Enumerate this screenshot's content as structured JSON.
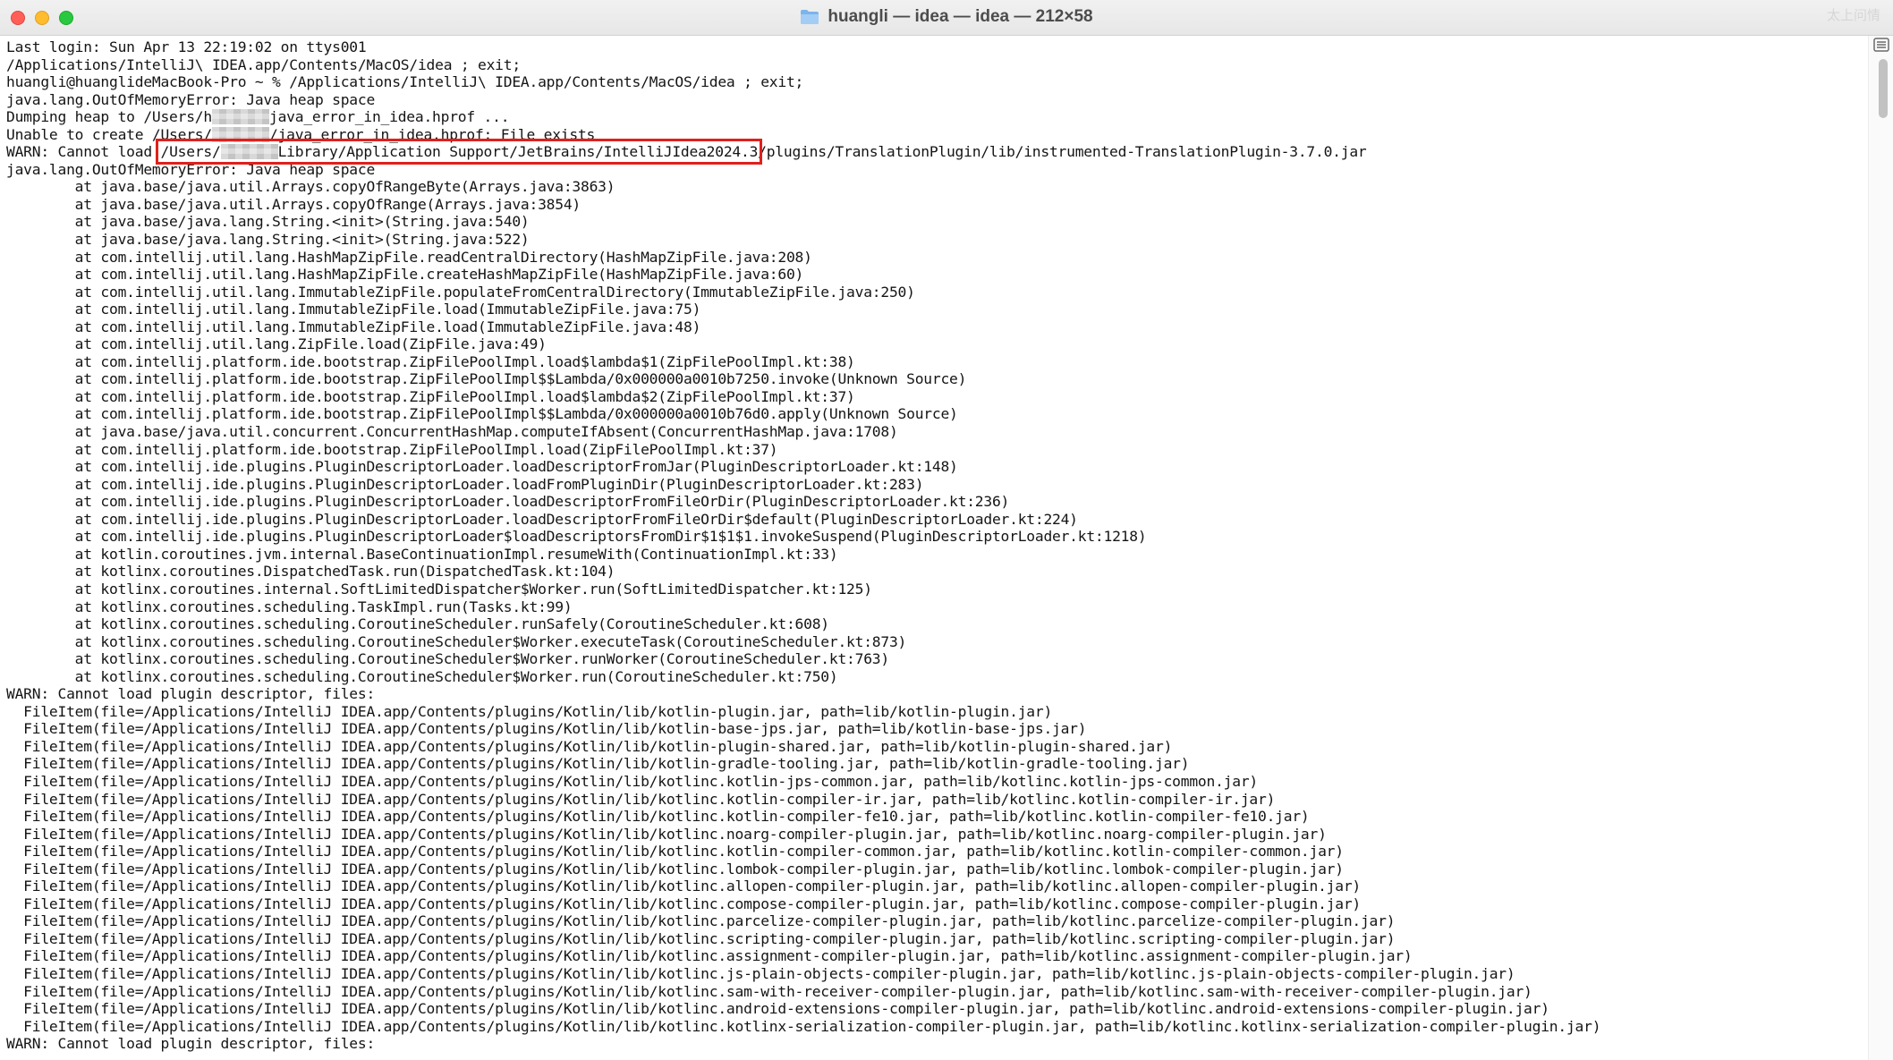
{
  "window": {
    "title": "huangli — idea — idea — 212×58",
    "watermark": "太上问情",
    "icon": "folder-icon",
    "controls": [
      "close-icon",
      "minimize-icon",
      "maximize-icon"
    ]
  },
  "terminal": {
    "highlight_color": "#e0201b",
    "lines": [
      [
        "Last login: Sun Apr 13 22:19:02 on ttys001"
      ],
      [
        "/Applications/IntelliJ\\ IDEA.app/Contents/MacOS/idea ; exit;"
      ],
      [
        "huangli@huanglideMacBook-Pro ~ % /Applications/IntelliJ\\ IDEA.app/Contents/MacOS/idea ; exit;"
      ],
      [
        "java.lang.OutOfMemoryError: Java heap space"
      ],
      [
        "Dumping heap to /Users/h",
        {
          "blur": true
        },
        "java_error_in_idea.hprof ..."
      ],
      [
        "Unable to create /Users/",
        {
          "blur": true
        },
        "/java_error_in_idea.hprof: File exists"
      ],
      [
        "WARN: Cannot load ",
        {
          "hl": "/Users/",
          "blur": true,
          "hl_end": "Library/Application Support/JetBrains/IntelliJIdea2024.3"
        },
        "/plugins/TranslationPlugin/lib/instrumented-TranslationPlugin-3.7.0.jar"
      ],
      [
        "java.lang.OutOfMemoryError: Java heap space"
      ],
      [
        "        at java.base/java.util.Arrays.copyOfRangeByte(Arrays.java:3863)"
      ],
      [
        "        at java.base/java.util.Arrays.copyOfRange(Arrays.java:3854)"
      ],
      [
        "        at java.base/java.lang.String.<init>(String.java:540)"
      ],
      [
        "        at java.base/java.lang.String.<init>(String.java:522)"
      ],
      [
        "        at com.intellij.util.lang.HashMapZipFile.readCentralDirectory(HashMapZipFile.java:208)"
      ],
      [
        "        at com.intellij.util.lang.HashMapZipFile.createHashMapZipFile(HashMapZipFile.java:60)"
      ],
      [
        "        at com.intellij.util.lang.ImmutableZipFile.populateFromCentralDirectory(ImmutableZipFile.java:250)"
      ],
      [
        "        at com.intellij.util.lang.ImmutableZipFile.load(ImmutableZipFile.java:75)"
      ],
      [
        "        at com.intellij.util.lang.ImmutableZipFile.load(ImmutableZipFile.java:48)"
      ],
      [
        "        at com.intellij.util.lang.ZipFile.load(ZipFile.java:49)"
      ],
      [
        "        at com.intellij.platform.ide.bootstrap.ZipFilePoolImpl.load$lambda$1(ZipFilePoolImpl.kt:38)"
      ],
      [
        "        at com.intellij.platform.ide.bootstrap.ZipFilePoolImpl$$Lambda/0x000000a0010b7250.invoke(Unknown Source)"
      ],
      [
        "        at com.intellij.platform.ide.bootstrap.ZipFilePoolImpl.load$lambda$2(ZipFilePoolImpl.kt:37)"
      ],
      [
        "        at com.intellij.platform.ide.bootstrap.ZipFilePoolImpl$$Lambda/0x000000a0010b76d0.apply(Unknown Source)"
      ],
      [
        "        at java.base/java.util.concurrent.ConcurrentHashMap.computeIfAbsent(ConcurrentHashMap.java:1708)"
      ],
      [
        "        at com.intellij.platform.ide.bootstrap.ZipFilePoolImpl.load(ZipFilePoolImpl.kt:37)"
      ],
      [
        "        at com.intellij.ide.plugins.PluginDescriptorLoader.loadDescriptorFromJar(PluginDescriptorLoader.kt:148)"
      ],
      [
        "        at com.intellij.ide.plugins.PluginDescriptorLoader.loadFromPluginDir(PluginDescriptorLoader.kt:283)"
      ],
      [
        "        at com.intellij.ide.plugins.PluginDescriptorLoader.loadDescriptorFromFileOrDir(PluginDescriptorLoader.kt:236)"
      ],
      [
        "        at com.intellij.ide.plugins.PluginDescriptorLoader.loadDescriptorFromFileOrDir$default(PluginDescriptorLoader.kt:224)"
      ],
      [
        "        at com.intellij.ide.plugins.PluginDescriptorLoader$loadDescriptorsFromDir$1$1$1.invokeSuspend(PluginDescriptorLoader.kt:1218)"
      ],
      [
        "        at kotlin.coroutines.jvm.internal.BaseContinuationImpl.resumeWith(ContinuationImpl.kt:33)"
      ],
      [
        "        at kotlinx.coroutines.DispatchedTask.run(DispatchedTask.kt:104)"
      ],
      [
        "        at kotlinx.coroutines.internal.SoftLimitedDispatcher$Worker.run(SoftLimitedDispatcher.kt:125)"
      ],
      [
        "        at kotlinx.coroutines.scheduling.TaskImpl.run(Tasks.kt:99)"
      ],
      [
        "        at kotlinx.coroutines.scheduling.CoroutineScheduler.runSafely(CoroutineScheduler.kt:608)"
      ],
      [
        "        at kotlinx.coroutines.scheduling.CoroutineScheduler$Worker.executeTask(CoroutineScheduler.kt:873)"
      ],
      [
        "        at kotlinx.coroutines.scheduling.CoroutineScheduler$Worker.runWorker(CoroutineScheduler.kt:763)"
      ],
      [
        "        at kotlinx.coroutines.scheduling.CoroutineScheduler$Worker.run(CoroutineScheduler.kt:750)"
      ],
      [
        "WARN: Cannot load plugin descriptor, files:"
      ],
      [
        "  FileItem(file=/Applications/IntelliJ IDEA.app/Contents/plugins/Kotlin/lib/kotlin-plugin.jar, path=lib/kotlin-plugin.jar)"
      ],
      [
        "  FileItem(file=/Applications/IntelliJ IDEA.app/Contents/plugins/Kotlin/lib/kotlin-base-jps.jar, path=lib/kotlin-base-jps.jar)"
      ],
      [
        "  FileItem(file=/Applications/IntelliJ IDEA.app/Contents/plugins/Kotlin/lib/kotlin-plugin-shared.jar, path=lib/kotlin-plugin-shared.jar)"
      ],
      [
        "  FileItem(file=/Applications/IntelliJ IDEA.app/Contents/plugins/Kotlin/lib/kotlin-gradle-tooling.jar, path=lib/kotlin-gradle-tooling.jar)"
      ],
      [
        "  FileItem(file=/Applications/IntelliJ IDEA.app/Contents/plugins/Kotlin/lib/kotlinc.kotlin-jps-common.jar, path=lib/kotlinc.kotlin-jps-common.jar)"
      ],
      [
        "  FileItem(file=/Applications/IntelliJ IDEA.app/Contents/plugins/Kotlin/lib/kotlinc.kotlin-compiler-ir.jar, path=lib/kotlinc.kotlin-compiler-ir.jar)"
      ],
      [
        "  FileItem(file=/Applications/IntelliJ IDEA.app/Contents/plugins/Kotlin/lib/kotlinc.kotlin-compiler-fe10.jar, path=lib/kotlinc.kotlin-compiler-fe10.jar)"
      ],
      [
        "  FileItem(file=/Applications/IntelliJ IDEA.app/Contents/plugins/Kotlin/lib/kotlinc.noarg-compiler-plugin.jar, path=lib/kotlinc.noarg-compiler-plugin.jar)"
      ],
      [
        "  FileItem(file=/Applications/IntelliJ IDEA.app/Contents/plugins/Kotlin/lib/kotlinc.kotlin-compiler-common.jar, path=lib/kotlinc.kotlin-compiler-common.jar)"
      ],
      [
        "  FileItem(file=/Applications/IntelliJ IDEA.app/Contents/plugins/Kotlin/lib/kotlinc.lombok-compiler-plugin.jar, path=lib/kotlinc.lombok-compiler-plugin.jar)"
      ],
      [
        "  FileItem(file=/Applications/IntelliJ IDEA.app/Contents/plugins/Kotlin/lib/kotlinc.allopen-compiler-plugin.jar, path=lib/kotlinc.allopen-compiler-plugin.jar)"
      ],
      [
        "  FileItem(file=/Applications/IntelliJ IDEA.app/Contents/plugins/Kotlin/lib/kotlinc.compose-compiler-plugin.jar, path=lib/kotlinc.compose-compiler-plugin.jar)"
      ],
      [
        "  FileItem(file=/Applications/IntelliJ IDEA.app/Contents/plugins/Kotlin/lib/kotlinc.parcelize-compiler-plugin.jar, path=lib/kotlinc.parcelize-compiler-plugin.jar)"
      ],
      [
        "  FileItem(file=/Applications/IntelliJ IDEA.app/Contents/plugins/Kotlin/lib/kotlinc.scripting-compiler-plugin.jar, path=lib/kotlinc.scripting-compiler-plugin.jar)"
      ],
      [
        "  FileItem(file=/Applications/IntelliJ IDEA.app/Contents/plugins/Kotlin/lib/kotlinc.assignment-compiler-plugin.jar, path=lib/kotlinc.assignment-compiler-plugin.jar)"
      ],
      [
        "  FileItem(file=/Applications/IntelliJ IDEA.app/Contents/plugins/Kotlin/lib/kotlinc.js-plain-objects-compiler-plugin.jar, path=lib/kotlinc.js-plain-objects-compiler-plugin.jar)"
      ],
      [
        "  FileItem(file=/Applications/IntelliJ IDEA.app/Contents/plugins/Kotlin/lib/kotlinc.sam-with-receiver-compiler-plugin.jar, path=lib/kotlinc.sam-with-receiver-compiler-plugin.jar)"
      ],
      [
        "  FileItem(file=/Applications/IntelliJ IDEA.app/Contents/plugins/Kotlin/lib/kotlinc.android-extensions-compiler-plugin.jar, path=lib/kotlinc.android-extensions-compiler-plugin.jar)"
      ],
      [
        "  FileItem(file=/Applications/IntelliJ IDEA.app/Contents/plugins/Kotlin/lib/kotlinc.kotlinx-serialization-compiler-plugin.jar, path=lib/kotlinc.kotlinx-serialization-compiler-plugin.jar)"
      ],
      [
        "WARN: Cannot load plugin descriptor, files:"
      ]
    ]
  }
}
